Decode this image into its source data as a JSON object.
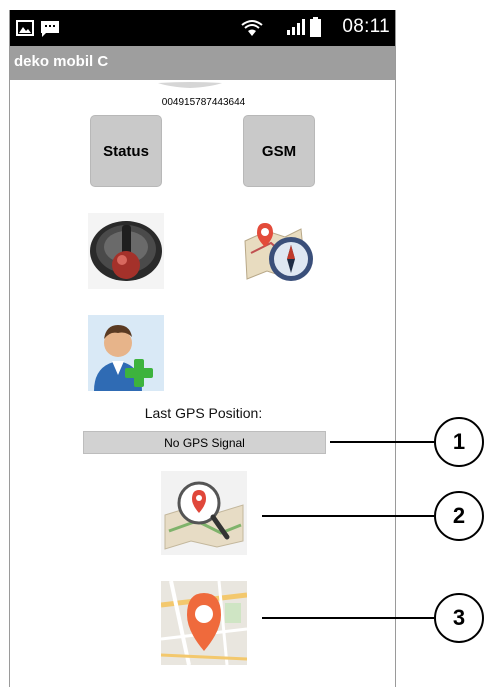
{
  "status_bar": {
    "time": "08:11",
    "icons": [
      "image-icon",
      "message-icon",
      "wifi-icon",
      "signal-icon",
      "battery-icon"
    ]
  },
  "app": {
    "title": "deko mobil C"
  },
  "device": {
    "number": "004915787443644"
  },
  "buttons": {
    "status_label": "Status",
    "gsm_label": "GSM"
  },
  "tiles": [
    "joystick-icon",
    "map-compass-icon",
    "add-user-icon"
  ],
  "gps": {
    "label": "Last GPS Position:",
    "value": "No GPS Signal"
  },
  "location_buttons": [
    "search-location-icon",
    "map-pin-icon"
  ],
  "callouts": [
    "1",
    "2",
    "3"
  ]
}
